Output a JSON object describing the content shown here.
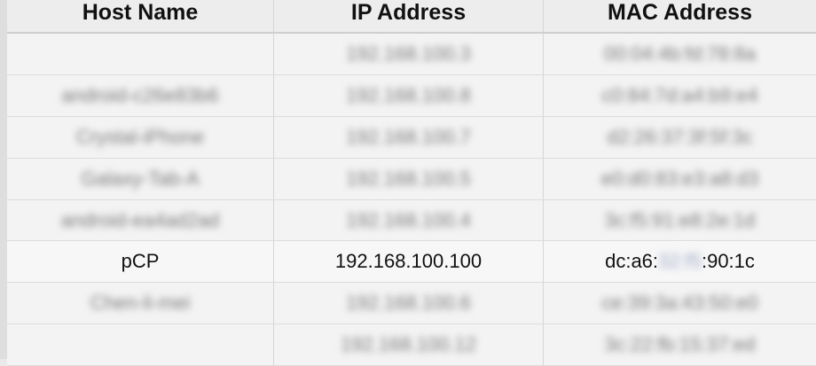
{
  "table": {
    "headers": [
      "Host Name",
      "IP Address",
      "MAC Address"
    ],
    "rows": [
      {
        "host": "",
        "ip": "192.168.100.3",
        "mac": "00:04:4b:fd:78:8a",
        "blurred": true
      },
      {
        "host": "android-c26e83b6",
        "ip": "192.168.100.8",
        "mac": "c0:84:7d:a4:b9:e4",
        "blurred": true
      },
      {
        "host": "Crystal-iPhone",
        "ip": "192.168.100.7",
        "mac": "d2:26:37:3f:5f:3c",
        "blurred": true
      },
      {
        "host": "Galaxy-Tab-A",
        "ip": "192.168.100.5",
        "mac": "e0:d0:83:e3:a8:d3",
        "blurred": true
      },
      {
        "host": "android-ea4ad2ad",
        "ip": "192.168.100.4",
        "mac": "3c:f5:91:e8:2e:1d",
        "blurred": true
      },
      {
        "host": "pCP",
        "ip": "192.168.100.100",
        "mac_prefix": "dc:a6:",
        "mac_masked": "32:f5",
        "mac_suffix": ":90:1c",
        "blurred": false
      },
      {
        "host": "Chen-li-mei",
        "ip": "192.168.100.6",
        "mac": "ce:39:3a:43:50:e0",
        "blurred": true
      },
      {
        "host": "",
        "ip": "192.168.100.12",
        "mac": "3c:22:fb:15:37:ed",
        "blurred": true
      }
    ]
  }
}
